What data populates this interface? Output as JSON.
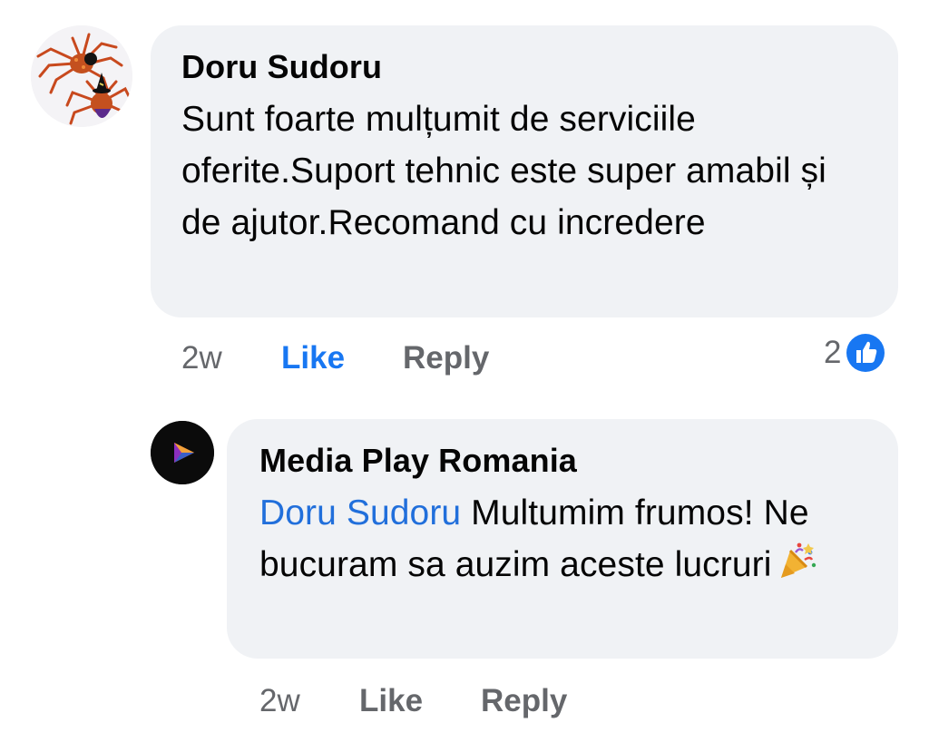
{
  "comment": {
    "author": "Doru Sudoru",
    "text": "Sunt foarte mulțumit de serviciile oferite.Suport tehnic este super amabil și de ajutor.Recomand cu incredere",
    "time": "2w",
    "like_label": "Like",
    "reply_label": "Reply",
    "reaction_count": "2",
    "reaction_icon": "thumbs-up-icon",
    "colors": {
      "like_active": "#1877f2",
      "bubble": "#f0f2f5",
      "meta": "#65676b"
    }
  },
  "reply": {
    "author": "Media Play Romania",
    "mention": "Doru Sudoru",
    "text": " Multumim frumos! Ne bucuram sa auzim aceste lucruri",
    "emoji": "party-popper-icon",
    "time": "2w",
    "like_label": "Like",
    "reply_label": "Reply",
    "colors": {
      "mention": "#216fdb"
    }
  }
}
